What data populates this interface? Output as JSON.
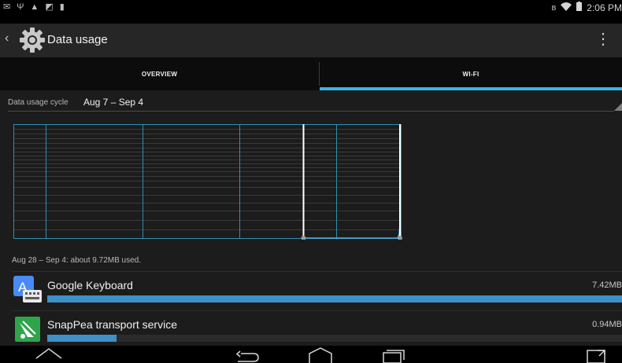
{
  "statusbar": {
    "time": "2:06 PM",
    "icons": [
      "mail-icon",
      "usb-icon",
      "lock-icon",
      "image-icon",
      "app-icon",
      "bluetooth-icon",
      "wifi-icon",
      "battery-icon"
    ]
  },
  "actionbar": {
    "title": "Data usage",
    "icon": "gear-icon"
  },
  "tabs": [
    {
      "label": "OVERVIEW",
      "selected": false
    },
    {
      "label": "WI-FI",
      "selected": true
    }
  ],
  "accent_color": "#33b5e5",
  "cycle": {
    "label": "Data usage cycle",
    "value": "Aug 7 – Sep 4"
  },
  "summary": "Aug 28 – Sep 4: about 9.72MB used.",
  "apps": [
    {
      "name": "Google Keyboard",
      "size": "7.42MB",
      "usage_fraction": 1.0,
      "icon": "google-keyboard-icon"
    },
    {
      "name": "SnapPea transport service",
      "size": "0.94MB",
      "usage_fraction": 0.12,
      "icon": "snappea-icon"
    }
  ],
  "navbar": [
    "back-button",
    "home-button",
    "recents-button",
    "fullscreen-button"
  ]
}
